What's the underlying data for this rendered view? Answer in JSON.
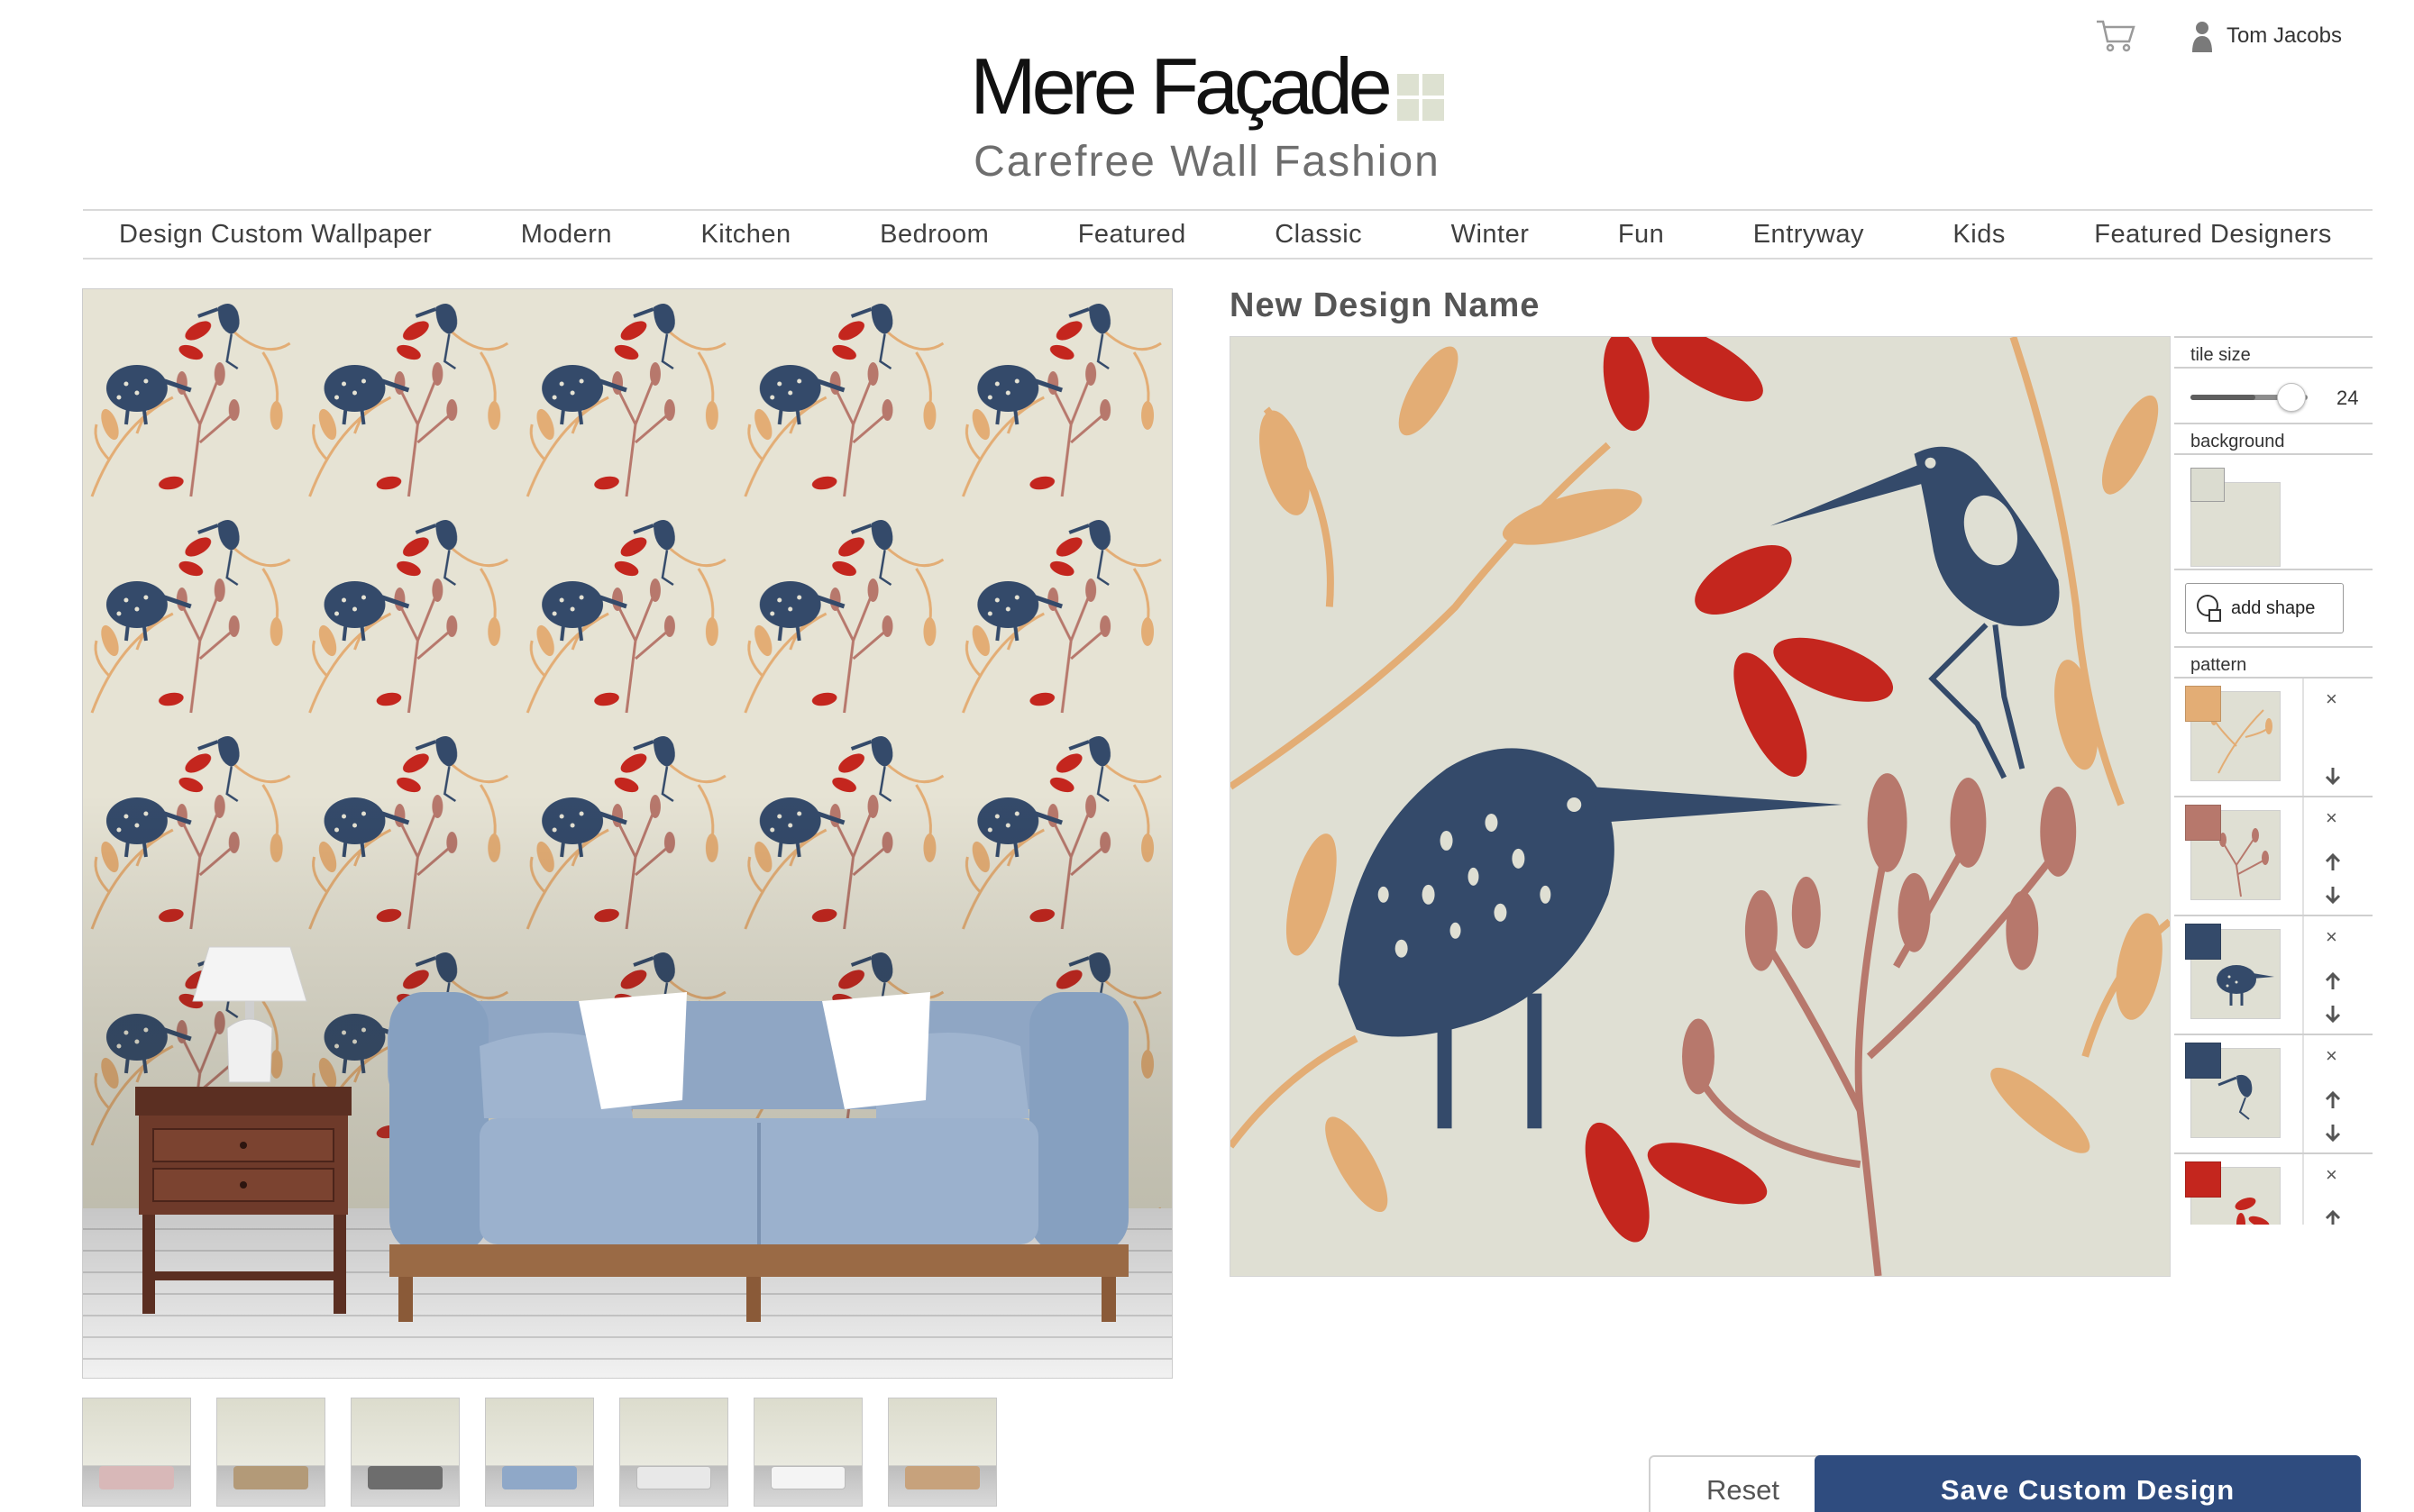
{
  "header": {
    "brand": "Mere Façade",
    "tagline": "Carefree Wall Fashion",
    "user_name": "Tom Jacobs",
    "cart_icon": "shopping-cart-icon",
    "user_icon": "user-icon"
  },
  "nav": [
    "Design Custom Wallpaper",
    "Modern",
    "Kitchen",
    "Bedroom",
    "Featured",
    "Classic",
    "Winter",
    "Fun",
    "Entryway",
    "Kids",
    "Featured Designers"
  ],
  "room_thumbnails": [
    {
      "name": "room-pink-sofa",
      "accent": "#d8b8b8"
    },
    {
      "name": "room-dining",
      "accent": "#b39a78"
    },
    {
      "name": "room-chairs",
      "accent": "#6d6d6d"
    },
    {
      "name": "room-desk",
      "accent": "#8a5a40"
    },
    {
      "name": "room-blue-sofa",
      "accent": "#8fa8c8"
    },
    {
      "name": "room-white-sofa",
      "accent": "#e8e8e8"
    },
    {
      "name": "room-doorway",
      "accent": "#f4f4f4"
    },
    {
      "name": "room-bed",
      "accent": "#c7a27c"
    }
  ],
  "editor": {
    "design_name": "New Design Name",
    "tile_size_label": "tile size",
    "tile_size_value": "24",
    "tile_size_fraction": 0.55,
    "background_label": "background",
    "background_color": "#dfdfd3",
    "add_shape_label": "add shape",
    "pattern_label": "pattern",
    "layers": [
      {
        "color": "#e3ad75",
        "shape": "leaves",
        "remove": "×"
      },
      {
        "color": "#b7786c",
        "shape": "stems",
        "remove": "×"
      },
      {
        "color": "#344a6a",
        "shape": "kiwi-bird",
        "remove": "×"
      },
      {
        "color": "#344a6a",
        "shape": "heron",
        "remove": "×"
      },
      {
        "color": "#c4261e",
        "shape": "red-leaves",
        "remove": "×"
      }
    ]
  },
  "buttons": {
    "reset": "Reset",
    "save": "Save Custom Design"
  },
  "colors": {
    "accent": "#2f4c7f",
    "navy": "#344a6a",
    "orange": "#e3ad75",
    "rose": "#b7786c",
    "red": "#c4261e",
    "background": "#dfdfd3"
  }
}
